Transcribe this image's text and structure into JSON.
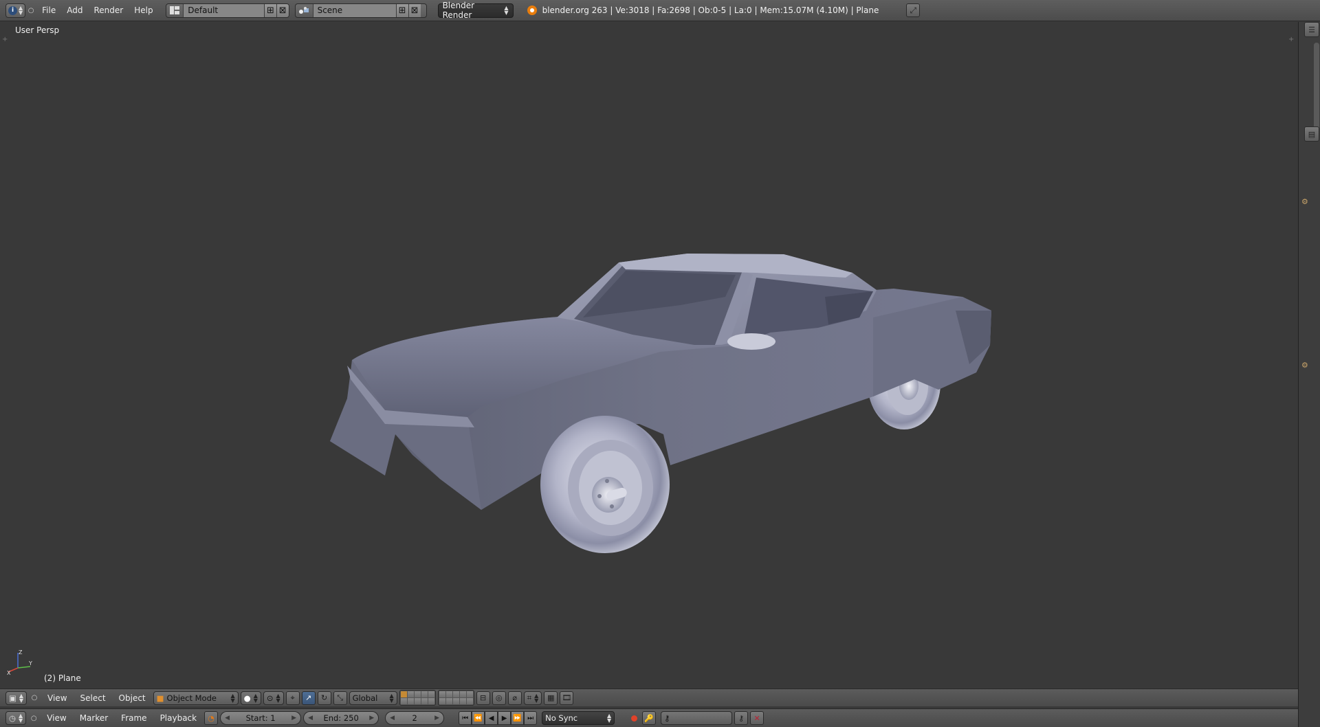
{
  "topbar": {
    "menus": [
      "File",
      "Add",
      "Render",
      "Help"
    ],
    "screen_layout": "Default",
    "scene": "Scene",
    "render_engine": "Blender Render",
    "stats": "blender.org 263 | Ve:3018 | Fa:2698 | Ob:0-5 | La:0 | Mem:15.07M (4.10M) | Plane"
  },
  "viewport": {
    "view_name": "User Persp",
    "active_object": "(2) Plane",
    "axis_labels": {
      "x": "X",
      "y": "Y",
      "z": "Z"
    }
  },
  "view3d_header": {
    "menus": [
      "View",
      "Select",
      "Object"
    ],
    "mode": "Object Mode",
    "transform_orientation": "Global"
  },
  "timeline_header": {
    "menus": [
      "View",
      "Marker",
      "Frame",
      "Playback"
    ],
    "start_frame": "Start: 1",
    "end_frame": "End: 250",
    "current_frame": "2",
    "sync_mode": "No Sync"
  },
  "colors": {
    "viewport_bg": "#393939",
    "header_bg": "#545454",
    "model_color": "#7b7e94",
    "accent_orange": "#e87d0d"
  }
}
